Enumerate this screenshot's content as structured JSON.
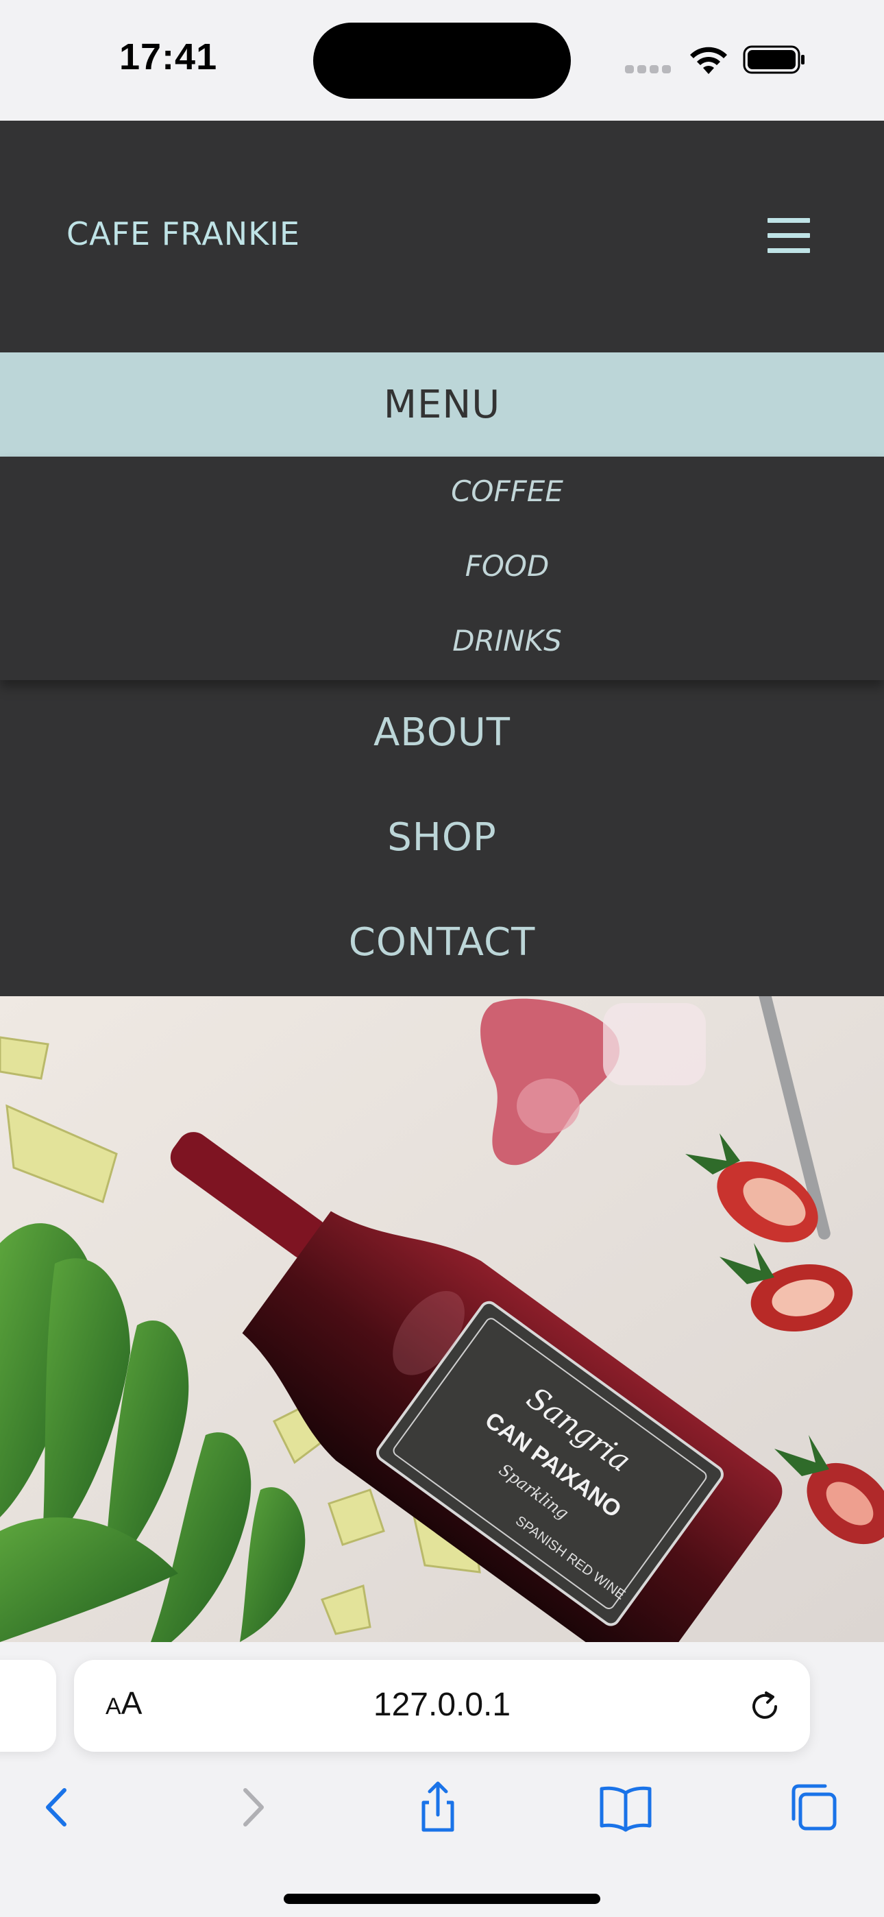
{
  "status_bar": {
    "time": "17:41"
  },
  "header": {
    "brand": "CAFE FRANKIE",
    "menu_icon": "hamburger-icon"
  },
  "nav": {
    "menu_label": "MENU",
    "submenu": [
      "COFFEE",
      "FOOD",
      "DRINKS"
    ],
    "items": [
      "ABOUT",
      "SHOP",
      "CONTACT"
    ]
  },
  "hero": {
    "image": "sangria-bottle-photo"
  },
  "browser": {
    "text_size_small": "A",
    "text_size_big": "A",
    "url": "127.0.0.1",
    "icons": [
      "reload-icon",
      "back-icon",
      "forward-icon",
      "share-icon",
      "bookmarks-icon",
      "tabs-icon"
    ]
  },
  "colors": {
    "header_bg": "#333334",
    "accent": "#bcd6d8",
    "brand_text": "#bfe3e6",
    "browser_blue": "#1a73e8"
  }
}
